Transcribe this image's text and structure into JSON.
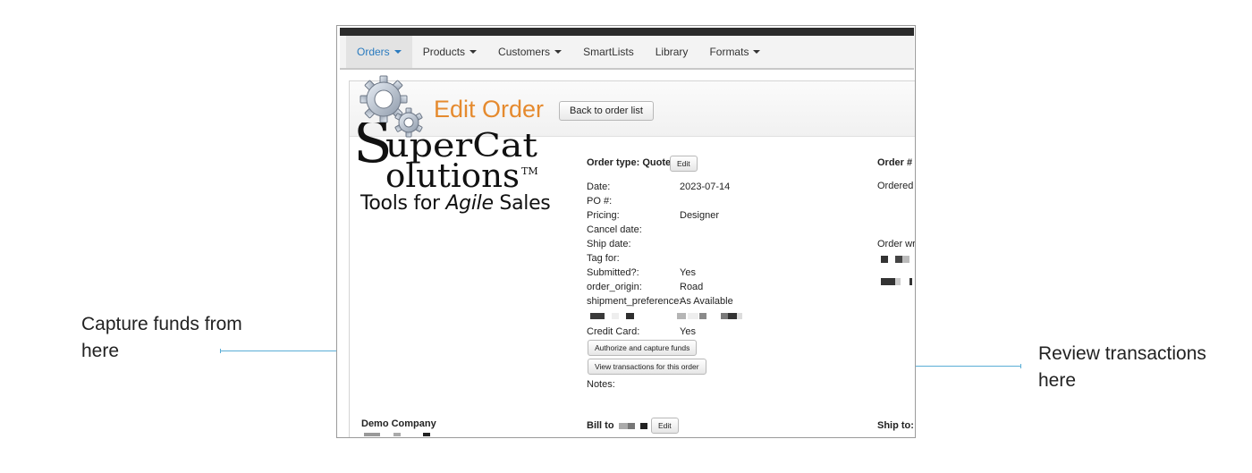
{
  "callouts": {
    "left": "Capture funds from here",
    "right": "Review transactions here"
  },
  "nav": {
    "items": [
      {
        "label": "Orders",
        "dropdown": true,
        "active": true
      },
      {
        "label": "Products",
        "dropdown": true,
        "active": false
      },
      {
        "label": "Customers",
        "dropdown": true,
        "active": false
      },
      {
        "label": "SmartLists",
        "dropdown": false,
        "active": false
      },
      {
        "label": "Library",
        "dropdown": false,
        "active": false
      },
      {
        "label": "Formats",
        "dropdown": true,
        "active": false
      }
    ]
  },
  "header": {
    "title": "Edit Order",
    "back_label": "Back to order list"
  },
  "logo": {
    "wordmark": "SuperCat Solutions",
    "trademark": "TM",
    "tagline_prefix": "Tools for ",
    "tagline_emphasis": "Agile",
    "tagline_suffix": " Sales"
  },
  "order": {
    "type_label": "Order type: Quote",
    "edit_label": "Edit",
    "number_label": "Order #",
    "ordered_label": "Ordered",
    "order_written_label": "Order wr",
    "fields": [
      {
        "label": "Date:",
        "value": "2023-07-14"
      },
      {
        "label": "PO #:",
        "value": ""
      },
      {
        "label": "Pricing:",
        "value": "Designer"
      },
      {
        "label": "Cancel date:",
        "value": ""
      },
      {
        "label": "Ship date:",
        "value": ""
      },
      {
        "label": "Tag for:",
        "value": ""
      },
      {
        "label": "Submitted?:",
        "value": "Yes"
      },
      {
        "label": "order_origin:",
        "value": "Road"
      },
      {
        "label": "shipment_preference:",
        "value": "As Available"
      }
    ],
    "credit_card_label": "Credit Card:",
    "credit_card_value": "Yes",
    "authorize_label": "Authorize and capture funds",
    "view_transactions_label": "View transactions for this order",
    "notes_label": "Notes:"
  },
  "footer": {
    "company": "Demo Company",
    "bill_to_label": "Bill to",
    "bill_edit_label": "Edit",
    "ship_to_label": "Ship to:"
  },
  "colors": {
    "accent_title": "#e58a2e",
    "nav_active": "#2a7bbf",
    "leader": "#5aaed6"
  }
}
